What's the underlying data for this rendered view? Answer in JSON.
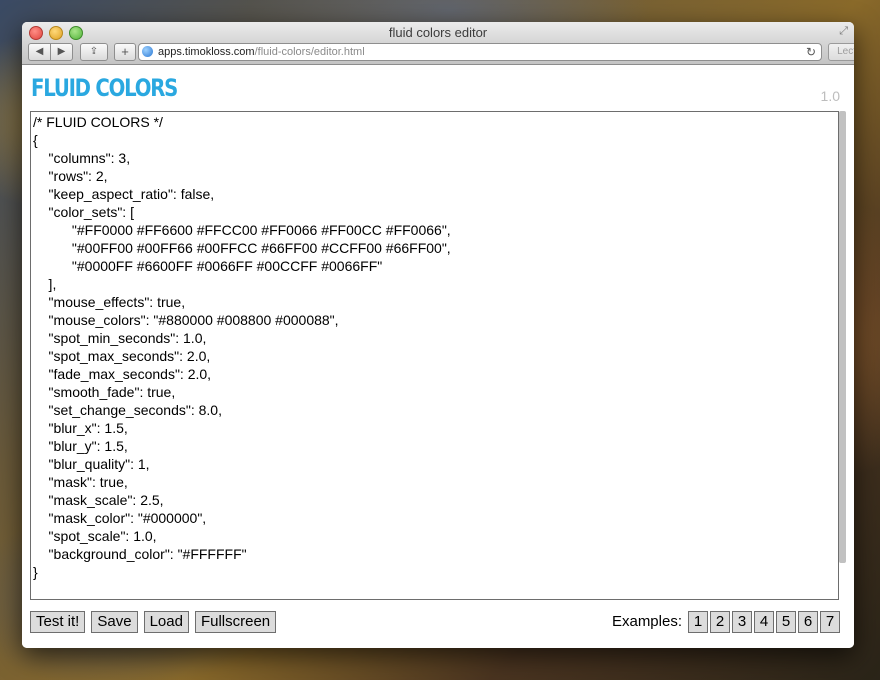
{
  "window": {
    "title": "fluid colors editor",
    "url_host": "apps.timokloss.com",
    "url_path": "/fluid-colors/editor.html",
    "reader_label": "Lector"
  },
  "page": {
    "logo_text": "FLUID COLORS",
    "version": "1.0",
    "editor_text": "/* FLUID COLORS */\n{\n    \"columns\": 3,\n    \"rows\": 2,\n    \"keep_aspect_ratio\": false,\n    \"color_sets\": [\n          \"#FF0000 #FF6600 #FFCC00 #FF0066 #FF00CC #FF0066\",\n          \"#00FF00 #00FF66 #00FFCC #66FF00 #CCFF00 #66FF00\",\n          \"#0000FF #6600FF #0066FF #00CCFF #0066FF\"\n    ],\n    \"mouse_effects\": true,\n    \"mouse_colors\": \"#880000 #008800 #000088\",\n    \"spot_min_seconds\": 1.0,\n    \"spot_max_seconds\": 2.0,\n    \"fade_max_seconds\": 2.0,\n    \"smooth_fade\": true,\n    \"set_change_seconds\": 8.0,\n    \"blur_x\": 1.5,\n    \"blur_y\": 1.5,\n    \"blur_quality\": 1,\n    \"mask\": true,\n    \"mask_scale\": 2.5,\n    \"mask_color\": \"#000000\",\n    \"spot_scale\": 1.0,\n    \"background_color\": \"#FFFFFF\"\n}",
    "buttons": {
      "test": "Test it!",
      "save": "Save",
      "load": "Load",
      "fullscreen": "Fullscreen"
    },
    "examples": {
      "label": "Examples:",
      "items": [
        "1",
        "2",
        "3",
        "4",
        "5",
        "6",
        "7"
      ]
    }
  },
  "colors": {
    "logo": "#2aa8e0",
    "version": "#bdbdbd"
  }
}
